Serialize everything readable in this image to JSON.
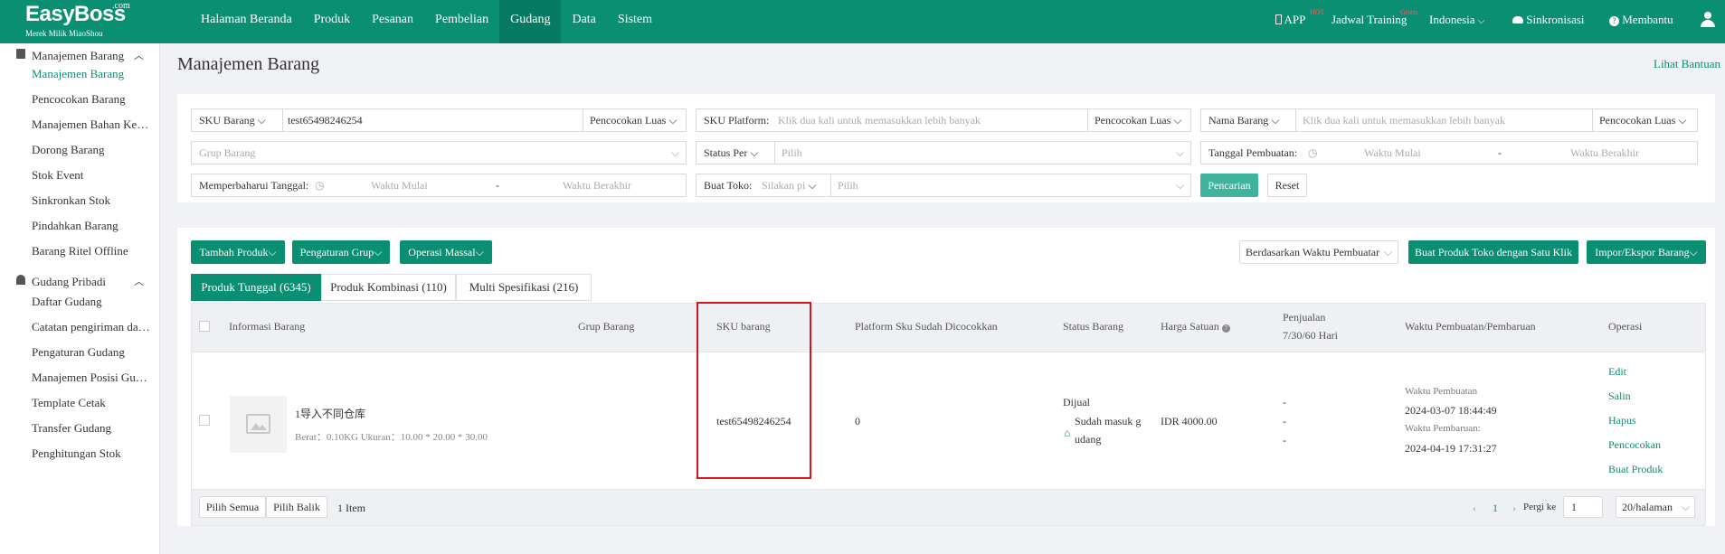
{
  "brand": {
    "name": "EasyBoss",
    "com": ".com",
    "sub": "Merek Milik MiaoShou"
  },
  "nav": [
    "Halaman Beranda",
    "Produk",
    "Pesanan",
    "Pembelian",
    "Gudang",
    "Data",
    "Sistem"
  ],
  "right_nav": {
    "app": "APP",
    "app_badge": "HOT",
    "training": "Jadwal Training",
    "training_badge": "Gratis",
    "language": "Indonesia",
    "sync": "Sinkronisasi",
    "help": "Membantu"
  },
  "sidebar": {
    "group1": "Manajemen Barang",
    "group1_items": [
      "Manajemen Barang",
      "Pencocokan Barang",
      "Manajemen Bahan Ke…",
      "Dorong Barang",
      "Stok Event",
      "Sinkronkan Stok",
      "Pindahkan Barang",
      "Barang Ritel Offline"
    ],
    "group2": "Gudang Pribadi",
    "group2_items": [
      "Daftar Gudang",
      "Catatan pengiriman da…",
      "Pengaturan Gudang",
      "Manajemen Posisi Gu…",
      "Template Cetak",
      "Transfer Gudang",
      "Penghitungan Stok"
    ]
  },
  "page": {
    "title": "Manajemen Barang",
    "help": "Lihat Bantuan"
  },
  "filters": {
    "sku_label": "SKU Barang",
    "sku_value": "test65498246254",
    "sku_match": "Pencocokan Luas",
    "platform_label": "SKU Platform:",
    "platform_ph": "Klik dua kali untuk memasukkan lebih banyak",
    "platform_match": "Pencocokan Luas",
    "name_label": "Nama Barang",
    "name_ph": "Klik dua kali untuk memasukkan lebih banyak",
    "name_match": "Pencocokan Luas",
    "group_ph": "Grup Barang",
    "status_label": "Status Per",
    "status_ph": "Pilih",
    "created_label": "Tanggal Pembuatan:",
    "created_start": "Waktu Mulai",
    "created_dash": "-",
    "created_end": "Waktu Berakhir",
    "updated_label": "Memperbaharui Tanggal:",
    "updated_start": "Waktu Mulai",
    "updated_dash": "-",
    "updated_end": "Waktu Berakhir",
    "shop_label": "Buat Toko:",
    "shop_ph": "Silakan pi",
    "shop_pick": "Pilih",
    "search": "Pencarian",
    "reset": "Reset"
  },
  "toolbar": {
    "add": "Tambah Produk",
    "group_settings": "Pengaturan Grup",
    "mass_ops": "Operasi Massal",
    "sort": "Berdasarkan Waktu Pembuatar",
    "one_click": "Buat Produk Toko dengan Satu Klik",
    "import_export": "Impor/Ekspor Barang"
  },
  "tabs": [
    "Produk Tunggal (6345)",
    "Produk Kombinasi (110)",
    "Multi Spesifikasi (216)"
  ],
  "table": {
    "headers": {
      "info": "Informasi Barang",
      "group": "Grup Barang",
      "sku": "SKU barang",
      "platform": "Platform Sku Sudah Dicocokkan",
      "status": "Status Barang",
      "price": "Harga Satuan",
      "sales": "Penjualan",
      "sales2": "7/30/60 Hari",
      "time": "Waktu Pembuatan/Pembaruan",
      "ops": "Operasi"
    },
    "row": {
      "name": "1导入不同仓库",
      "spec": "Berat：0.10KG   Ukuran：10.00 * 20.00 * 30.00",
      "sku": "test65498246254",
      "platform": "0",
      "status": "Dijual",
      "status2": "Sudah masuk g",
      "status3": "udang",
      "price": "IDR 4000.00",
      "sales": [
        "-",
        "-",
        "-"
      ],
      "created_label": "Waktu Pembuatan",
      "created": "2024-03-07 18:44:49",
      "updated_label": "Waktu Pembaruan:",
      "updated": "2024-04-19 17:31:27",
      "ops": [
        "Edit",
        "Salin",
        "Hapus",
        "Pencocokan",
        "Buat Produk"
      ]
    }
  },
  "footer": {
    "select_all": "Pilih Semua",
    "invert": "Pilih Balik",
    "count": "1 Item",
    "page": "1",
    "goto": "Pergi ke",
    "goto_value": "1",
    "page_size": "20/halaman"
  },
  "colors": {
    "accent": "#0a8f73",
    "highlight": "#d9141b"
  }
}
